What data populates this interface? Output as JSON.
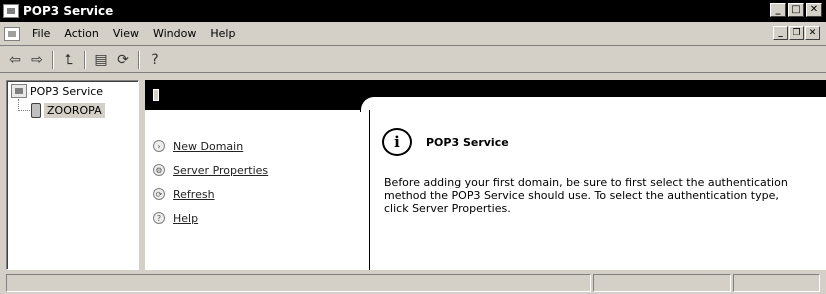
{
  "window": {
    "title": "POP3 Service"
  },
  "menu": {
    "items": [
      {
        "label": "File"
      },
      {
        "label": "Action"
      },
      {
        "label": "View"
      },
      {
        "label": "Window"
      },
      {
        "label": "Help"
      }
    ]
  },
  "toolbar": {
    "buttons": [
      "back-icon",
      "forward-icon",
      "up-icon",
      "properties-icon",
      "refresh-icon",
      "help-icon"
    ]
  },
  "tree": {
    "root": "POP3 Service",
    "child": "ZOOROPA"
  },
  "tasks": [
    {
      "label": "New Domain",
      "icon": "new-domain-icon"
    },
    {
      "label": "Server Properties",
      "icon": "server-properties-icon"
    },
    {
      "label": "Refresh",
      "icon": "refresh-icon"
    },
    {
      "label": "Help",
      "icon": "help-icon"
    }
  ],
  "info": {
    "title": "POP3 Service",
    "text": "Before adding your first domain, be sure to first select the authentication method the POP3 Service should use. To select the authentication type, click Server Properties."
  }
}
